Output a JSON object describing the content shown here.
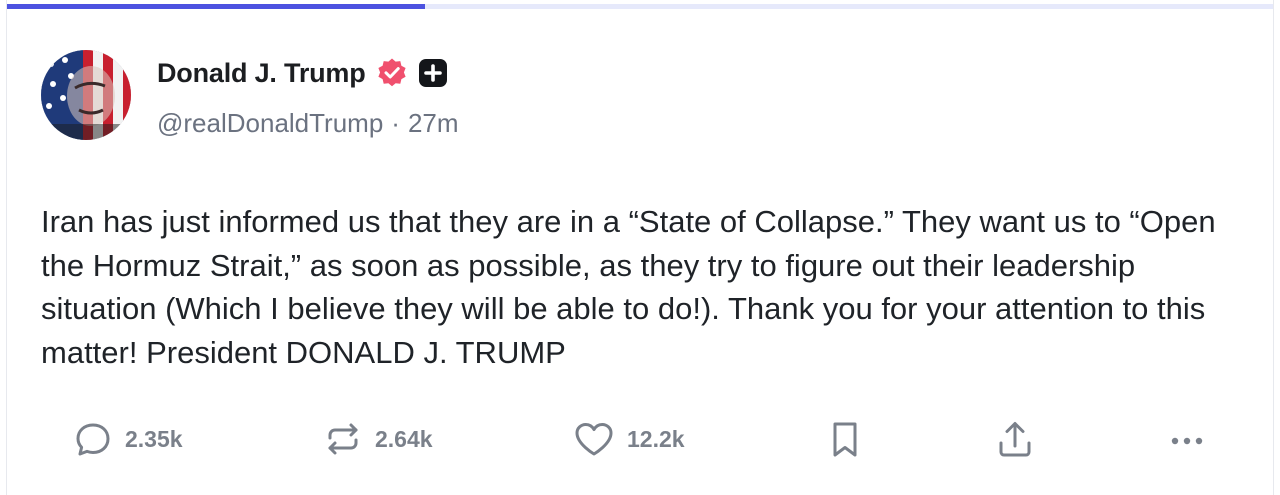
{
  "header": {
    "progress": 0.33
  },
  "author": {
    "display_name": "Donald J. Trump",
    "handle": "@realDonaldTrump",
    "separator": "·",
    "time_ago": "27m",
    "verified_icon": "verified-badge-icon",
    "verified_color": "#f0506e",
    "plus_icon": "plus-square-icon"
  },
  "post": {
    "text": "Iran has just informed us that they are in a “State of Collapse.” They want us to “Open the Hormuz Strait,” as soon as possible, as they try to figure out their leadership situation (Which I believe they will be able to do!). Thank you for your attention to this matter! President DONALD J. TRUMP"
  },
  "actions": {
    "replies": "2.35k",
    "retruths": "2.64k",
    "likes": "12.2k",
    "icons": [
      "reply-icon",
      "retruth-icon",
      "heart-icon",
      "bookmark-icon",
      "share-icon",
      "more-icon"
    ]
  },
  "colors": {
    "accent": "#4c52e0",
    "muted": "#7a808a",
    "text": "#1f2328"
  }
}
